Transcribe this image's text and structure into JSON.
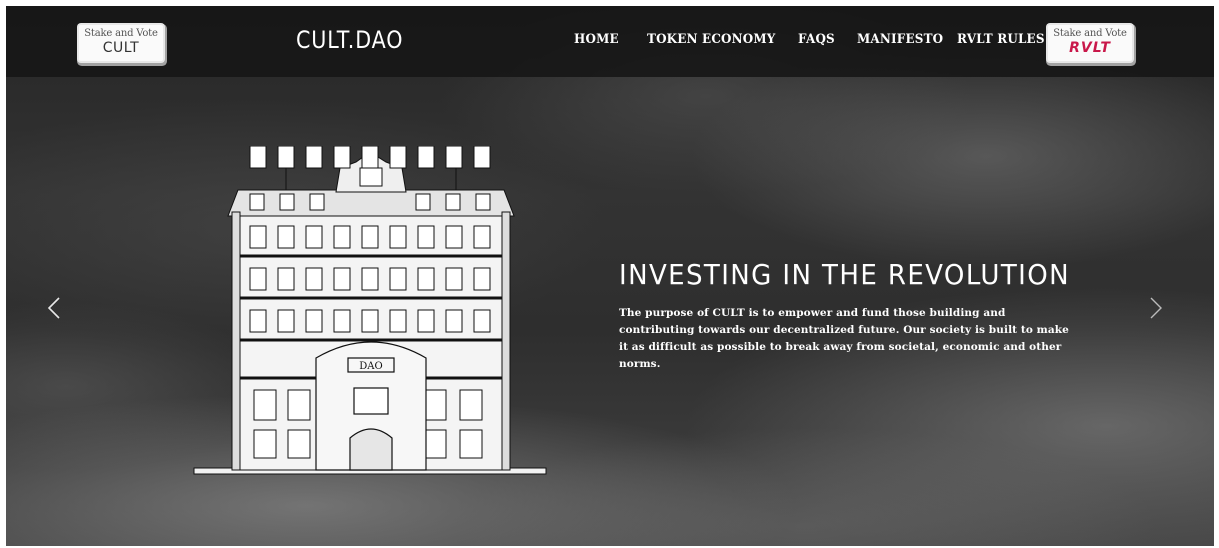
{
  "navbar": {
    "logo": "CULT.DAO",
    "stake_cult": {
      "line1": "Stake and Vote",
      "token": "CULT"
    },
    "stake_rvlt": {
      "line1": "Stake and Vote",
      "token": "RVLT"
    },
    "links": [
      "HOME",
      "TOKEN ECONOMY",
      "FAQS",
      "MANIFESTO",
      "RVLT RULES"
    ]
  },
  "hero": {
    "building_sign": "DAO",
    "title": "INVESTING IN THE REVOLUTION",
    "description": "The purpose of CULT is to empower and fund those building and contributing towards our decentralized future. Our society is built to make it as difficult as possible to break away from societal, economic and other norms."
  },
  "carousel": {
    "prev_icon": "chevron-left-icon",
    "next_icon": "chevron-right-icon"
  },
  "colors": {
    "accent_rvlt": "#c9184a",
    "nav_bg": "#161616",
    "text": "#ffffff"
  }
}
